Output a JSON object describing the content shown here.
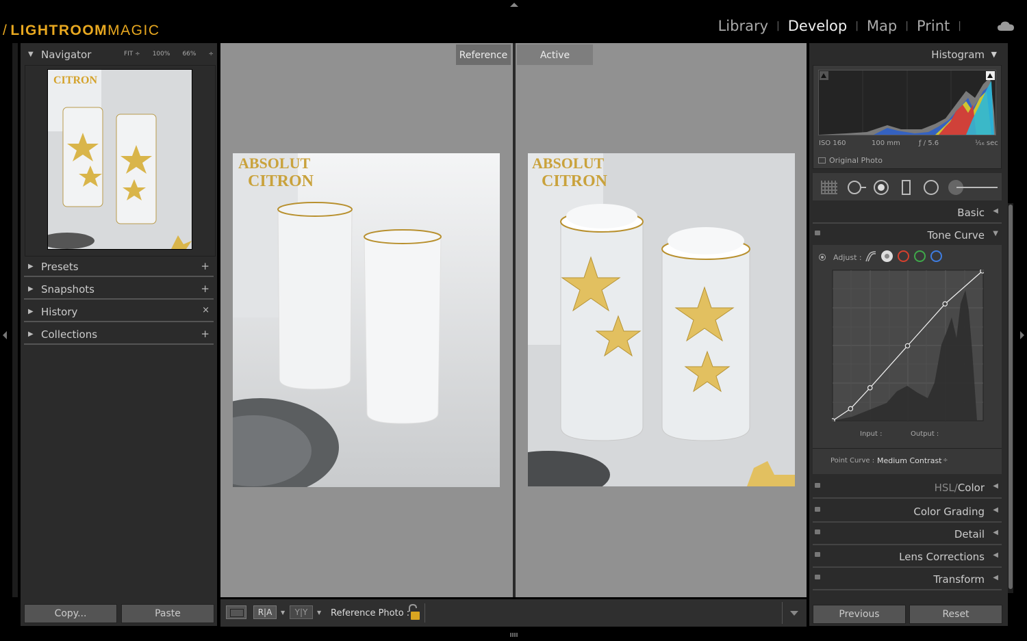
{
  "app": {
    "logo_bold": "LIGHTROOM",
    "logo_light": "MAGIC",
    "logo_slash": "/",
    "accent_color": "#e8a820"
  },
  "modules": {
    "items": [
      "Library",
      "Develop",
      "Map",
      "Print"
    ],
    "active": "Develop",
    "separator": "|",
    "cloud_icon": "cloud-icon"
  },
  "navigator": {
    "title": "Navigator",
    "zoom_fit": "FIT ÷",
    "zoom_100": "100%",
    "zoom_66": "66%",
    "zoom_arrow": "÷"
  },
  "left_panels": [
    {
      "label": "Presets",
      "control": "+"
    },
    {
      "label": "Snapshots",
      "control": "+"
    },
    {
      "label": "History",
      "control": "×"
    },
    {
      "label": "Collections",
      "control": "+"
    }
  ],
  "left_footer": {
    "copy": "Copy...",
    "paste": "Paste"
  },
  "center": {
    "reference_label": "Reference",
    "active_label": "Active",
    "toolbar": {
      "ra_label": "R|A",
      "yy_label": "Y|Y",
      "reference_photo_label": "Reference Photo :"
    }
  },
  "histogram": {
    "title": "Histogram",
    "iso": "ISO 160",
    "focal": "100 mm",
    "aperture": "ƒ / 5.6",
    "shutter": "¹⁄₁₆ sec",
    "original_photo": "Original Photo"
  },
  "right_panels": {
    "basic": "Basic",
    "tone_curve": "Tone Curve",
    "adjust_label": "Adjust :",
    "input_label": "Input :",
    "output_label": "Output :",
    "point_curve_label": "Point Curve :",
    "point_curve_value": "Medium Contrast",
    "hsl": "HSL",
    "color": "Color",
    "hsl_sep": "/",
    "color_grading": "Color Grading",
    "detail": "Detail",
    "lens_corrections": "Lens Corrections",
    "transform": "Transform"
  },
  "right_footer": {
    "previous": "Previous",
    "reset": "Reset"
  },
  "tone_curve_points": [
    [
      0,
      0
    ],
    [
      0.12,
      0.08
    ],
    [
      0.25,
      0.22
    ],
    [
      0.5,
      0.5
    ],
    [
      0.75,
      0.78
    ],
    [
      1,
      1
    ]
  ]
}
